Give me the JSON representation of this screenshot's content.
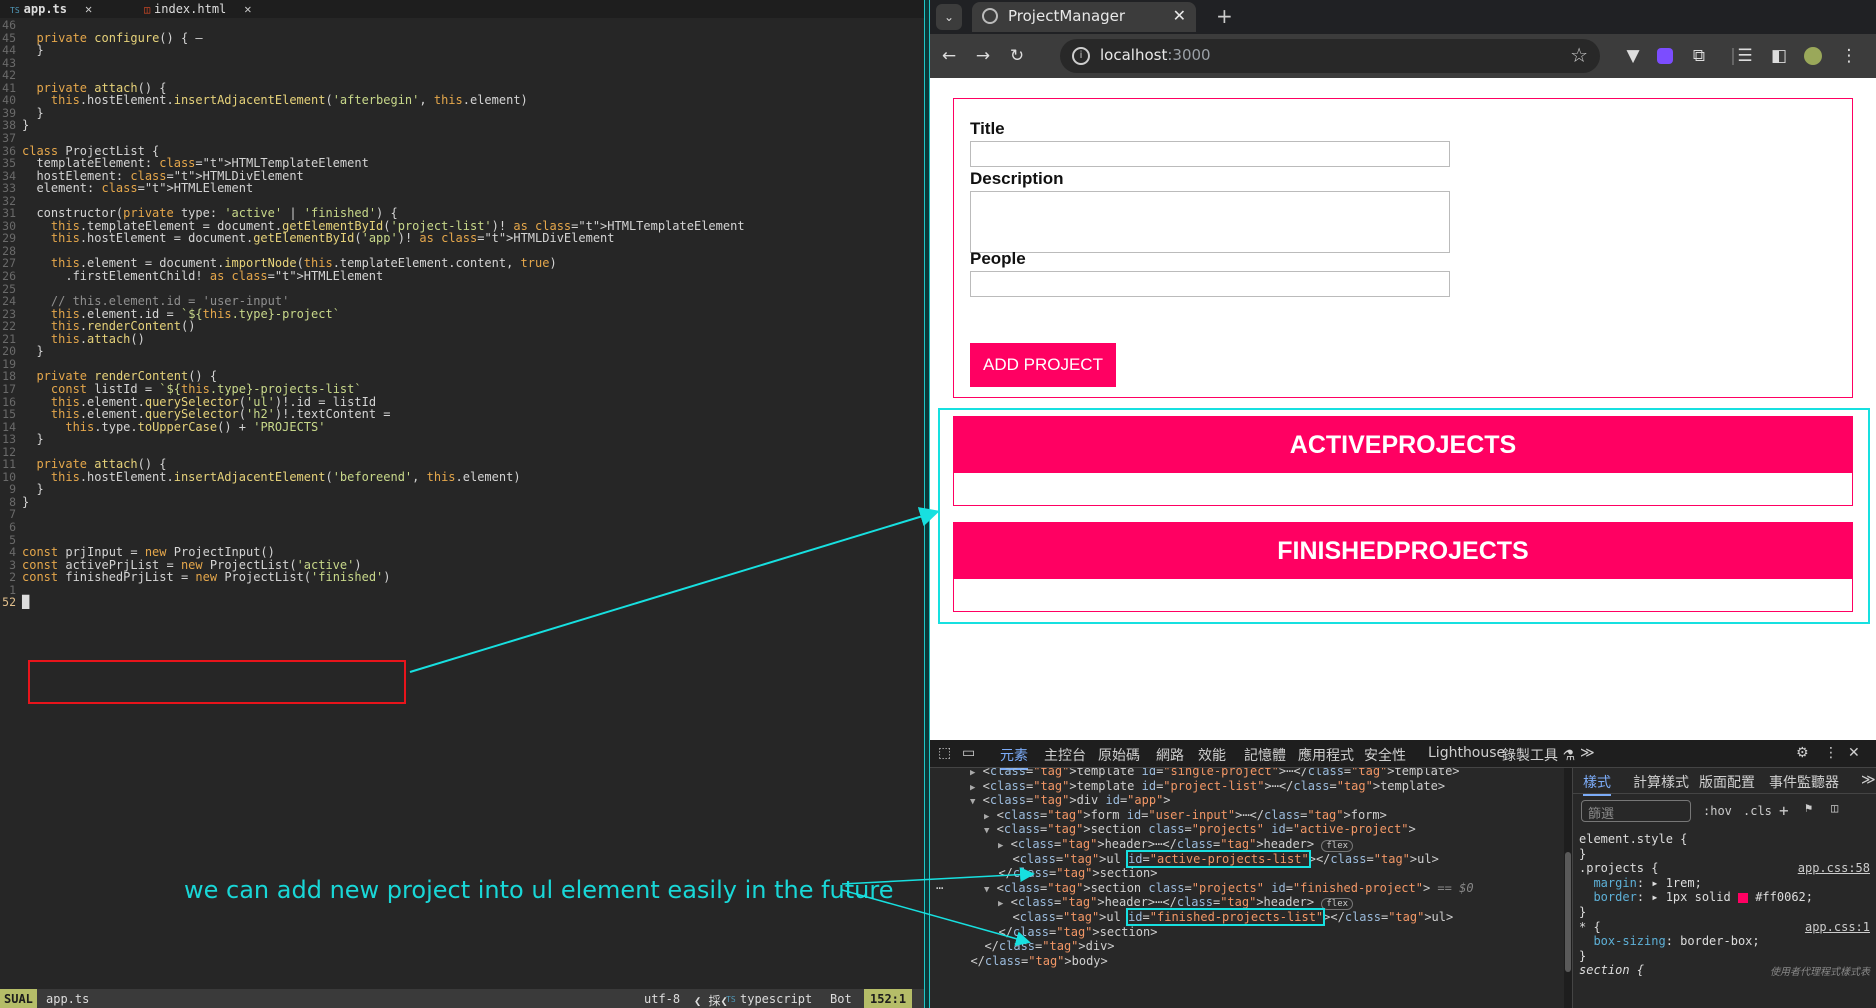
{
  "editor": {
    "tabs": [
      {
        "name": "app.ts",
        "icon": "TS",
        "close": "✕"
      },
      {
        "name": "index.html",
        "icon": "◫",
        "close": "✕"
      }
    ],
    "lines": [
      {
        "n": "46",
        "text": ""
      },
      {
        "n": "45",
        "text": "  private configure() { –"
      },
      {
        "n": "44",
        "text": "  }"
      },
      {
        "n": "43",
        "text": ""
      },
      {
        "n": "42",
        "text": ""
      },
      {
        "n": "41",
        "text": "  private attach() {"
      },
      {
        "n": "40",
        "text": "    this.hostElement.insertAdjacentElement('afterbegin', this.element)"
      },
      {
        "n": "39",
        "text": "  }"
      },
      {
        "n": "38",
        "text": "}"
      },
      {
        "n": "37",
        "text": ""
      },
      {
        "n": "36",
        "text": "class ProjectList {"
      },
      {
        "n": "35",
        "text": "  templateElement: HTMLTemplateElement"
      },
      {
        "n": "34",
        "text": "  hostElement: HTMLDivElement"
      },
      {
        "n": "33",
        "text": "  element: HTMLElement"
      },
      {
        "n": "32",
        "text": ""
      },
      {
        "n": "31",
        "text": "  constructor(private type: 'active' | 'finished') {"
      },
      {
        "n": "30",
        "text": "    this.templateElement = document.getElementById('project-list')! as HTMLTemplateElement"
      },
      {
        "n": "29",
        "text": "    this.hostElement = document.getElementById('app')! as HTMLDivElement"
      },
      {
        "n": "28",
        "text": ""
      },
      {
        "n": "27",
        "text": "    this.element = document.importNode(this.templateElement.content, true)"
      },
      {
        "n": "26",
        "text": "      .firstElementChild! as HTMLElement"
      },
      {
        "n": "25",
        "text": ""
      },
      {
        "n": "24",
        "text": "    // this.element.id = 'user-input'"
      },
      {
        "n": "23",
        "text": "    this.element.id = `${this.type}-project`"
      },
      {
        "n": "22",
        "text": "    this.renderContent()"
      },
      {
        "n": "21",
        "text": "    this.attach()"
      },
      {
        "n": "20",
        "text": "  }"
      },
      {
        "n": "19",
        "text": ""
      },
      {
        "n": "18",
        "text": "  private renderContent() {"
      },
      {
        "n": "17",
        "text": "    const listId = `${this.type}-projects-list`"
      },
      {
        "n": "16",
        "text": "    this.element.querySelector('ul')!.id = listId"
      },
      {
        "n": "15",
        "text": "    this.element.querySelector('h2')!.textContent ="
      },
      {
        "n": "14",
        "text": "      this.type.toUpperCase() + 'PROJECTS'"
      },
      {
        "n": "13",
        "text": "  }"
      },
      {
        "n": "12",
        "text": ""
      },
      {
        "n": "11",
        "text": "  private attach() {"
      },
      {
        "n": "10",
        "text": "    this.hostElement.insertAdjacentElement('beforeend', this.element)"
      },
      {
        "n": "9",
        "text": "  }"
      },
      {
        "n": "8",
        "text": "}"
      },
      {
        "n": "7",
        "text": ""
      },
      {
        "n": "6",
        "text": ""
      },
      {
        "n": "5",
        "text": ""
      },
      {
        "n": "4",
        "text": "const prjInput = new ProjectInput()"
      },
      {
        "n": "3",
        "text": "const activePrjList = new ProjectList('active')"
      },
      {
        "n": "2",
        "text": "const finishedPrjList = new ProjectList('finished')"
      },
      {
        "n": "1",
        "text": ""
      },
      {
        "n": "52",
        "text": "█"
      }
    ],
    "status": {
      "mode": "SUAL",
      "file": "app.ts",
      "encoding": "utf-8",
      "lang_icon": "TS",
      "filetype": "typescript",
      "scroll": "Bot",
      "position": "152:1"
    }
  },
  "annotation": "we can add new project into ul element easily in the future",
  "browser": {
    "tab_title": "ProjectManager",
    "tab_close": "✕",
    "new_tab": "+",
    "url_host": "localhost",
    "url_port": ":3000",
    "page": {
      "title_label": "Title",
      "description_label": "Description",
      "people_label": "People",
      "submit_label": "ADD PROJECT",
      "active_header": "ACTIVEPROJECTS",
      "finished_header": "FINISHEDPROJECTS"
    },
    "colors": {
      "accent": "#ff0062",
      "annotation": "#19d7d7"
    }
  },
  "devtools": {
    "tabs": [
      "元素",
      "主控台",
      "原始碼",
      "網路",
      "效能",
      "記憶體",
      "應用程式",
      "安全性",
      "Lighthouse",
      "錄製工具 ⚗"
    ],
    "more": "≫",
    "dom_lines": [
      {
        "indent": 0,
        "tri": "▶",
        "html": "<template id=\"single-project\">⋯</template>"
      },
      {
        "indent": 0,
        "tri": "▶",
        "html": "<template id=\"project-list\">⋯</template>"
      },
      {
        "indent": 0,
        "tri": "▼",
        "html": "<div id=\"app\">"
      },
      {
        "indent": 1,
        "tri": "▶",
        "html": "<form id=\"user-input\">⋯</form>"
      },
      {
        "indent": 1,
        "tri": "▼",
        "html": "<section class=\"projects\" id=\"active-project\">"
      },
      {
        "indent": 2,
        "tri": "▶",
        "html": "<header>⋯</header>",
        "badge": "flex"
      },
      {
        "indent": 2,
        "tri": "",
        "html": "<ul id=\"active-projects-list\"></ul>"
      },
      {
        "indent": 1,
        "tri": "",
        "html": "</section>"
      },
      {
        "indent": 1,
        "tri": "▼",
        "html": "<section class=\"projects\" id=\"finished-project\">",
        "suffix": "== $0"
      },
      {
        "indent": 2,
        "tri": "▶",
        "html": "<header>⋯</header>",
        "badge": "flex"
      },
      {
        "indent": 2,
        "tri": "",
        "html": "<ul id=\"finished-projects-list\"></ul>"
      },
      {
        "indent": 1,
        "tri": "",
        "html": "</section>"
      },
      {
        "indent": 0,
        "tri": "",
        "html": "</div>"
      },
      {
        "indent": -1,
        "tri": "",
        "html": "</body>"
      }
    ],
    "styles": {
      "tabs": [
        "樣式",
        "計算樣式",
        "版面配置",
        "事件監聽器"
      ],
      "more": "≫",
      "filter_placeholder": "篩選",
      "hov": ":hov",
      "cls": ".cls",
      "lines": [
        {
          "text": "element.style {",
          "src": ""
        },
        {
          "text": "}",
          "src": ""
        },
        {
          "text": ".projects {",
          "src": "app.css:58"
        },
        {
          "text": "  margin: ▸ 1rem;",
          "src": ""
        },
        {
          "text": "  border: ▸ 1px solid ■ #ff0062;",
          "src": ""
        },
        {
          "text": "}",
          "src": ""
        },
        {
          "text": "* {",
          "src": "app.css:1"
        },
        {
          "text": "  box-sizing: border-box;",
          "src": ""
        },
        {
          "text": "}",
          "src": ""
        },
        {
          "text": "section {",
          "src": "使用者代理程式樣式表"
        }
      ]
    }
  }
}
